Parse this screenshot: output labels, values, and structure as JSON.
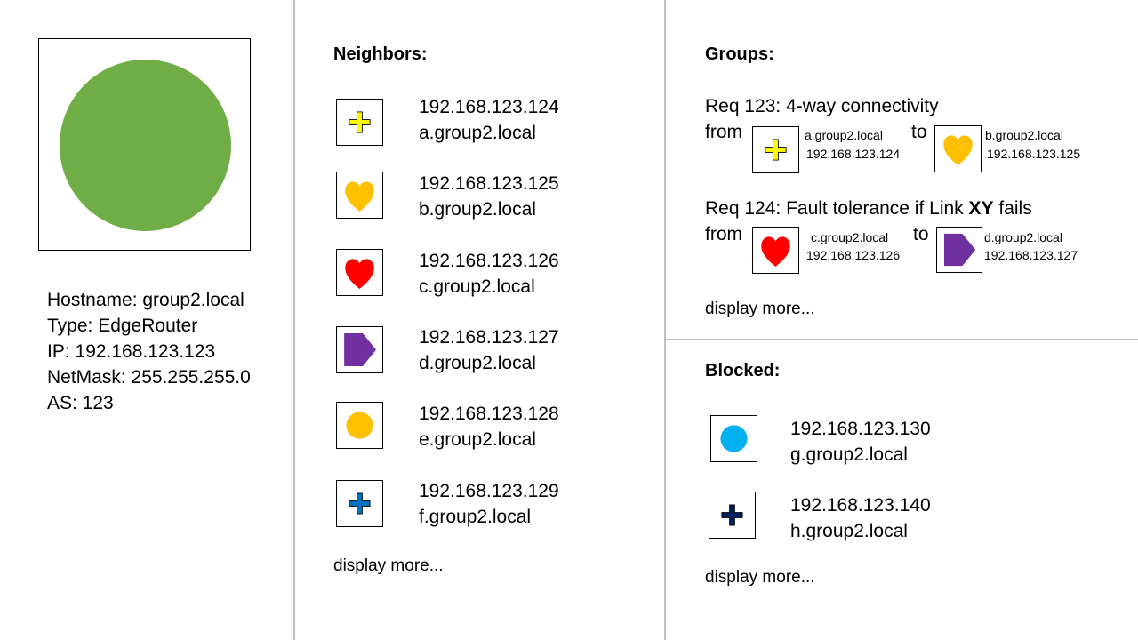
{
  "device": {
    "status_color": "#70AD47",
    "info": [
      "Hostname: group2.local",
      "Type: EdgeRouter",
      "IP: 192.168.123.123",
      "NetMask: 255.255.255.0",
      "AS: 123"
    ]
  },
  "neighbors": {
    "title": "Neighbors:",
    "items": [
      {
        "ip": "192.168.123.124",
        "host": "a.group2.local",
        "icon": "cross-icon",
        "color": "#FFFF00"
      },
      {
        "ip": "192.168.123.125",
        "host": "b.group2.local",
        "icon": "heart-icon",
        "color": "#FFC000"
      },
      {
        "ip": "192.168.123.126",
        "host": "c.group2.local",
        "icon": "heart-icon",
        "color": "#FF0000"
      },
      {
        "ip": "192.168.123.127",
        "host": "d.group2.local",
        "icon": "pentagon-arrow-icon",
        "color": "#7030A0"
      },
      {
        "ip": "192.168.123.128",
        "host": "e.group2.local",
        "icon": "circle-icon",
        "color": "#FFC000"
      },
      {
        "ip": "192.168.123.129",
        "host": "f.group2.local",
        "icon": "cross-icon",
        "color": "#0070C0"
      }
    ],
    "more": "display more..."
  },
  "groups": {
    "title": "Groups:",
    "requirements": [
      {
        "title": "Req 123: 4-way connectivity",
        "from_label": "from",
        "to_label": "to",
        "from": {
          "host": "a.group2.local",
          "ip": "192.168.123.124",
          "icon": "cross-icon",
          "color": "#FFFF00"
        },
        "to": {
          "host": "b.group2.local",
          "ip": "192.168.123.125",
          "icon": "heart-icon",
          "color": "#FFC000"
        }
      },
      {
        "title_prefix": "Req 124: Fault tolerance if Link ",
        "title_bold": "XY",
        "title_suffix": " fails",
        "from_label": "from",
        "to_label": "to",
        "from": {
          "host": "c.group2.local",
          "ip": "192.168.123.126",
          "icon": "heart-icon",
          "color": "#FF0000"
        },
        "to": {
          "host": "d.group2.local",
          "ip": "192.168.123.127",
          "icon": "pentagon-arrow-icon",
          "color": "#7030A0"
        }
      }
    ],
    "more": "display more..."
  },
  "blocked": {
    "title": "Blocked:",
    "items": [
      {
        "ip": "192.168.123.130",
        "host": "g.group2.local",
        "icon": "circle-icon",
        "color": "#00B0F0"
      },
      {
        "ip": "192.168.123.140",
        "host": "h.group2.local",
        "icon": "cross-icon",
        "color": "#002060"
      }
    ],
    "more": "display more..."
  }
}
